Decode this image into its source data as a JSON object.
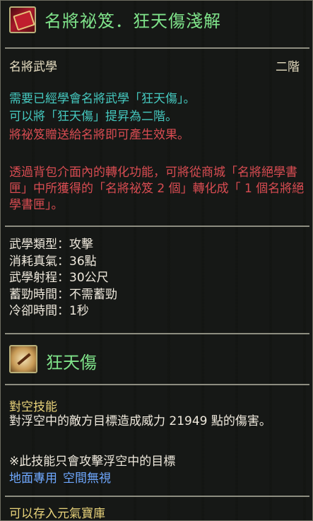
{
  "item": {
    "title": "名將祕笈．狂天傷淺解",
    "category": "名將武學",
    "grade": "二階"
  },
  "description": {
    "requirement": "需要已經學會名將武學「狂天傷」。",
    "upgrade": "可以將「狂天傷」提昇為二階。",
    "gift_note": "將祕笈贈送給名將即可產生效果。",
    "convert_note": "透過背包介面內的轉化功能，可將從商城「名將絕學書匣」中所獲得的「名將祕笈 2 個」轉化成「 1 個名將絕學書匣」。"
  },
  "stats": [
    {
      "label": "武學類型：",
      "value": "攻擊"
    },
    {
      "label": "消耗真氣：",
      "value": "36點"
    },
    {
      "label": "武學射程：",
      "value": "30公尺"
    },
    {
      "label": "蓄勁時間：",
      "value": "不需蓄勁"
    },
    {
      "label": "冷卻時間：",
      "value": "1秒"
    }
  ],
  "skill": {
    "name": "狂天傷",
    "type": "對空技能",
    "effect": "對浮空中的敵方目標造成威力 21949 點的傷害。",
    "note": "※此技能只會攻擊浮空中的目標",
    "tags": [
      "地面專用",
      "空間無視"
    ]
  },
  "footer": {
    "storage": "可以存入元氣寶庫"
  },
  "icons": {
    "item_icon": "red-book-icon",
    "skill_icon": "skill-slash-icon"
  },
  "colors": {
    "title_green": "#7fe38a",
    "cyan_text": "#45c9c0",
    "red_text": "#d94c52",
    "gold_text": "#e8d27a",
    "blue_tag": "#6fa8ff"
  }
}
